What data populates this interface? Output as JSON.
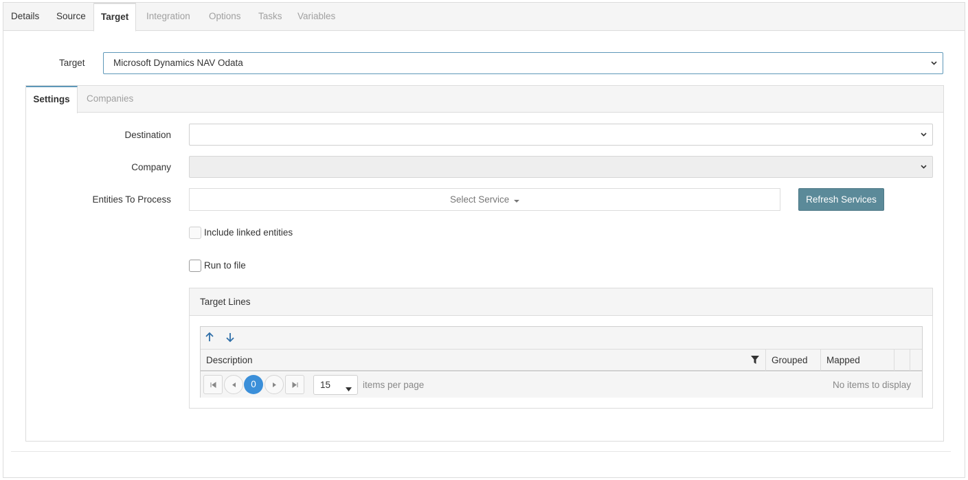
{
  "tabs": [
    {
      "label": "Details",
      "state": "normal"
    },
    {
      "label": "Source",
      "state": "normal"
    },
    {
      "label": "Target",
      "state": "active"
    },
    {
      "label": "Integration",
      "state": "disabled"
    },
    {
      "label": "Options",
      "state": "disabled"
    },
    {
      "label": "Tasks",
      "state": "disabled"
    },
    {
      "label": "Variables",
      "state": "disabled"
    }
  ],
  "target": {
    "label": "Target",
    "value": "Microsoft Dynamics NAV Odata"
  },
  "subtabs": [
    {
      "label": "Settings",
      "state": "active"
    },
    {
      "label": "Companies",
      "state": "disabled"
    }
  ],
  "settings": {
    "destination_label": "Destination",
    "destination_value": "",
    "company_label": "Company",
    "company_value": "",
    "entities_label": "Entities To Process",
    "entities_placeholder": "Select Service",
    "refresh_label": "Refresh Services",
    "include_linked_label": "Include linked entities",
    "include_linked_checked": false,
    "run_to_file_label": "Run to file",
    "run_to_file_checked": false
  },
  "target_lines": {
    "title": "Target Lines",
    "columns": [
      "Description",
      "Grouped",
      "Mapped",
      ""
    ],
    "rows": [],
    "pager": {
      "current_page": "0",
      "page_size": "15",
      "items_per_page_label": "items per page",
      "empty_text": "No items to display"
    }
  },
  "colors": {
    "accent": "#5d97b8",
    "button": "#5b8a99",
    "pager_active": "#3b8fd9"
  }
}
